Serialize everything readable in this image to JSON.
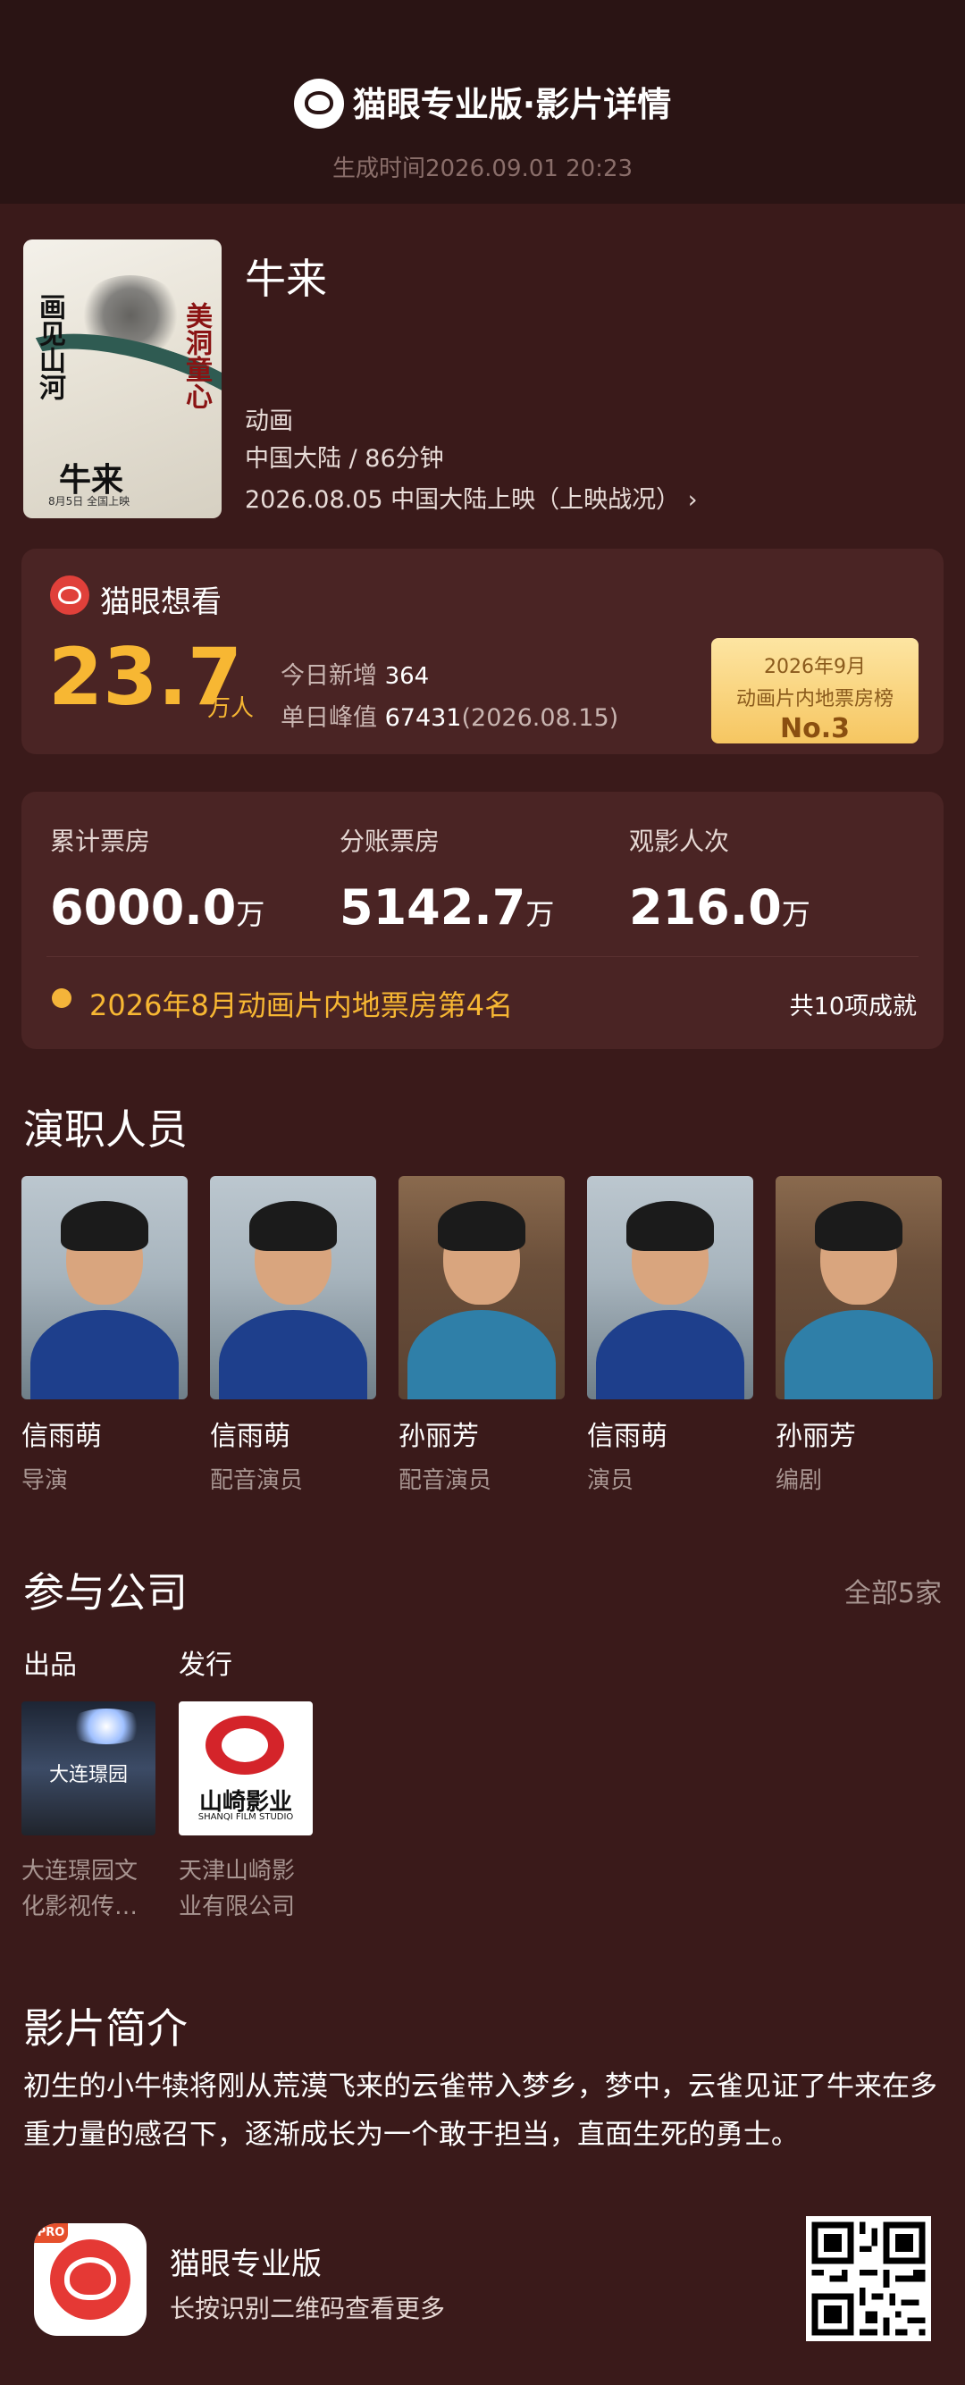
{
  "header": {
    "brand": "猫眼专业版",
    "page": "·影片详情",
    "generated": "生成时间2026.09.01 20:23"
  },
  "movie": {
    "title": "牛来",
    "poster_text": [
      "画见山河",
      "美洞童心",
      "牛来",
      "8月5日 全国上映"
    ],
    "genre": "动画",
    "region_duration": "中国大陆 / 86分钟",
    "release": "2026.08.05 中国大陆上映（上映战况）",
    "release_arrow": "›"
  },
  "want": {
    "label": "猫眼想看",
    "count": "23.7",
    "unit": "万人",
    "today_label": "今日新增",
    "today_value": "364",
    "peak_label": "单日峰值",
    "peak_value": "67431",
    "peak_date": "(2026.08.15)",
    "rank_line1": "2026年9月",
    "rank_line2": "动画片内地票房榜",
    "rank_no": "No.3"
  },
  "boxoffice": {
    "items": [
      {
        "label": "累计票房",
        "value": "6000.0",
        "unit": "万"
      },
      {
        "label": "分账票房",
        "value": "5142.7",
        "unit": "万"
      },
      {
        "label": "观影人次",
        "value": "216.0",
        "unit": "万"
      }
    ],
    "achievement": "2026年8月动画片内地票房第4名",
    "total": "共10项成就"
  },
  "cast": {
    "title": "演职人员",
    "members": [
      {
        "name": "信雨萌",
        "role": "导演",
        "gender": "m"
      },
      {
        "name": "信雨萌",
        "role": "配音演员",
        "gender": "m"
      },
      {
        "name": "孙丽芳",
        "role": "配音演员",
        "gender": "f"
      },
      {
        "name": "信雨萌",
        "role": "演员",
        "gender": "m"
      },
      {
        "name": "孙丽芳",
        "role": "编剧",
        "gender": "f"
      }
    ]
  },
  "companies": {
    "title": "参与公司",
    "all": "全部5家",
    "produce_label": "出品",
    "distribute_label": "发行",
    "produce": {
      "logo_text": "大连璟园",
      "name_line1": "大连璟园文",
      "name_line2": "化影视传…"
    },
    "distribute": {
      "logo_text": "山崎影业",
      "logo_sub": "SHANQI FILM STUDIO",
      "name_line1": "天津山崎影",
      "name_line2": "业有限公司"
    }
  },
  "intro": {
    "title": "影片简介",
    "text": "初生的小牛犊将刚从荒漠飞来的云雀带入梦乡，梦中，云雀见证了牛来在多重力量的感召下，逐渐成长为一个敢于担当，直面生死的勇士。"
  },
  "footer": {
    "badge": "PRO",
    "app_name": "猫眼专业版",
    "hint": "长按识别二维码查看更多"
  }
}
